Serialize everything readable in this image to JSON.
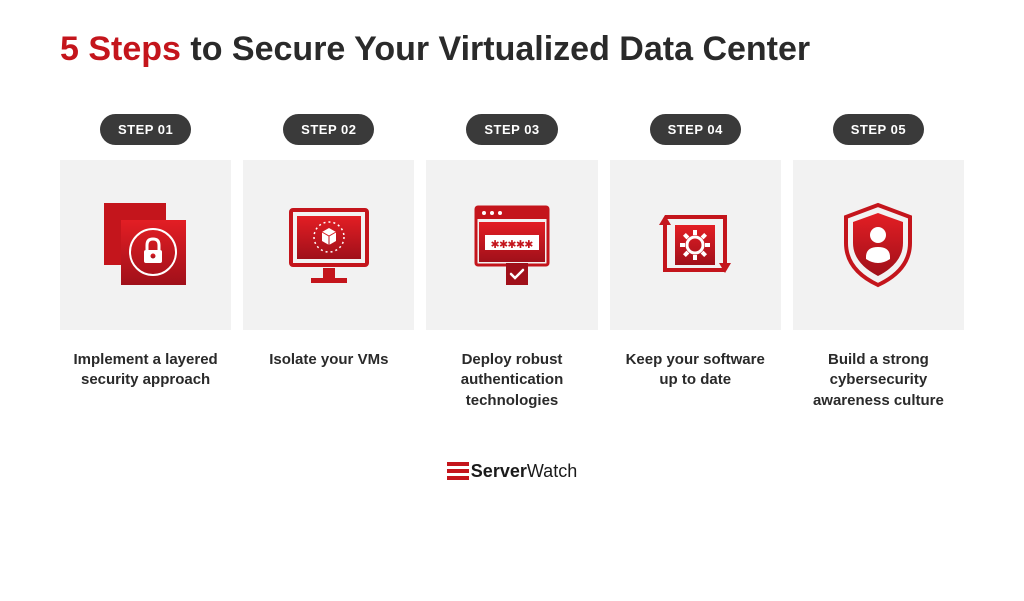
{
  "title": {
    "accent": "5 Steps",
    "rest": " to Secure Your Virtualized Data Center"
  },
  "steps": [
    {
      "badge": "STEP 01",
      "description": "Implement a layered security approach"
    },
    {
      "badge": "STEP 02",
      "description": "Isolate your VMs"
    },
    {
      "badge": "STEP 03",
      "description": "Deploy robust authentication technologies"
    },
    {
      "badge": "STEP 04",
      "description": "Keep your software up to date"
    },
    {
      "badge": "STEP 05",
      "description": "Build a strong cybersecurity awareness culture"
    }
  ],
  "footer": {
    "brand_bold": "Server",
    "brand_light": "Watch"
  },
  "colors": {
    "accent": "#c4151c",
    "dark": "#3a3a3a",
    "light_bg": "#f2f2f2"
  }
}
